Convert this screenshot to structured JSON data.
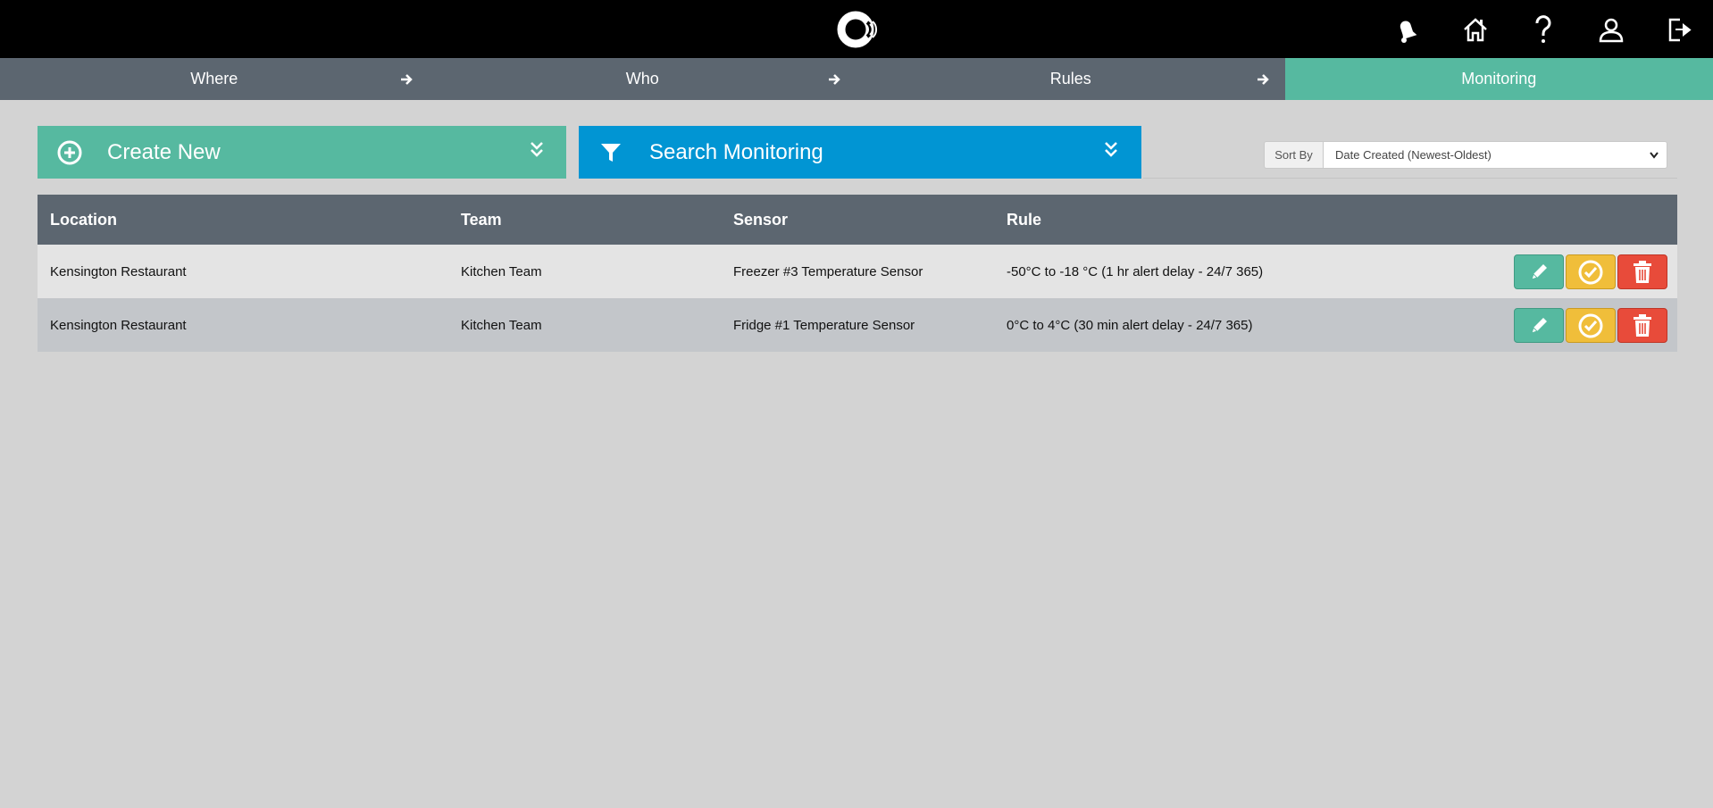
{
  "header": {
    "icons": [
      "bell-icon",
      "home-icon",
      "help-icon",
      "user-icon",
      "logout-icon"
    ]
  },
  "steps": [
    {
      "label": "Where",
      "active": false
    },
    {
      "label": "Who",
      "active": false
    },
    {
      "label": "Rules",
      "active": false
    },
    {
      "label": "Monitoring",
      "active": true
    }
  ],
  "panels": {
    "create_label": "Create New",
    "search_label": "Search Monitoring"
  },
  "sort": {
    "label": "Sort By",
    "selected": "Date Created (Newest-Oldest)"
  },
  "table": {
    "headers": [
      "Location",
      "Team",
      "Sensor",
      "Rule"
    ],
    "rows": [
      [
        "Kensington Restaurant",
        "Kitchen Team",
        "Freezer #3 Temperature Sensor",
        "-50°C to -18 °C (1 hr alert delay - 24/7 365)"
      ],
      [
        "Kensington Restaurant",
        "Kitchen Team",
        "Fridge #1 Temperature Sensor",
        "0°C to 4°C (30 min alert delay - 24/7 365)"
      ]
    ]
  },
  "colors": {
    "accent_green": "#56b9a0",
    "accent_blue": "#0195d3",
    "warning_yellow": "#f0be3a",
    "danger_red": "#e84b3a",
    "header_gray": "#5c6670"
  }
}
